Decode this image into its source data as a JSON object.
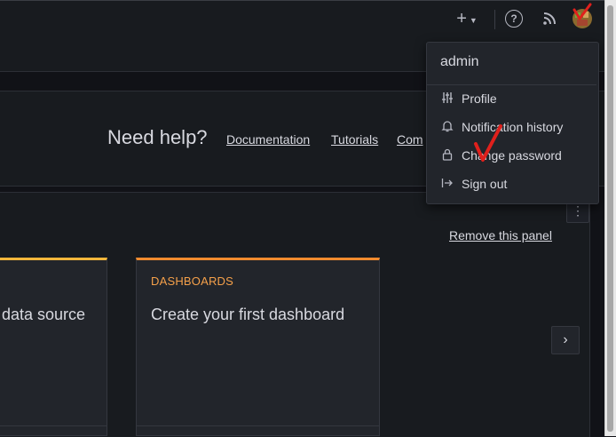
{
  "topbar": {
    "icons": [
      "plus-icon",
      "chevron-down-icon",
      "help-icon",
      "rss-icon",
      "avatar"
    ]
  },
  "help": {
    "heading": "Need help?",
    "links": [
      "Documentation",
      "Tutorials",
      "Com"
    ]
  },
  "panel": {
    "remove_label": "Remove this panel"
  },
  "cards": [
    {
      "title": "data source"
    },
    {
      "category": "DASHBOARDS",
      "title": "Create your first dashboard"
    }
  ],
  "profile_menu": {
    "username": "admin",
    "items": [
      {
        "label": "Profile",
        "icon": "sliders-icon"
      },
      {
        "label": "Notification history",
        "icon": "bell-icon"
      },
      {
        "label": "Change password",
        "icon": "lock-icon"
      },
      {
        "label": "Sign out",
        "icon": "sign-out-icon"
      }
    ]
  },
  "colors": {
    "accent_orange": "#f5a04a",
    "card_border_yellow": "#f5b73b",
    "annotation_red": "#e0201c"
  }
}
